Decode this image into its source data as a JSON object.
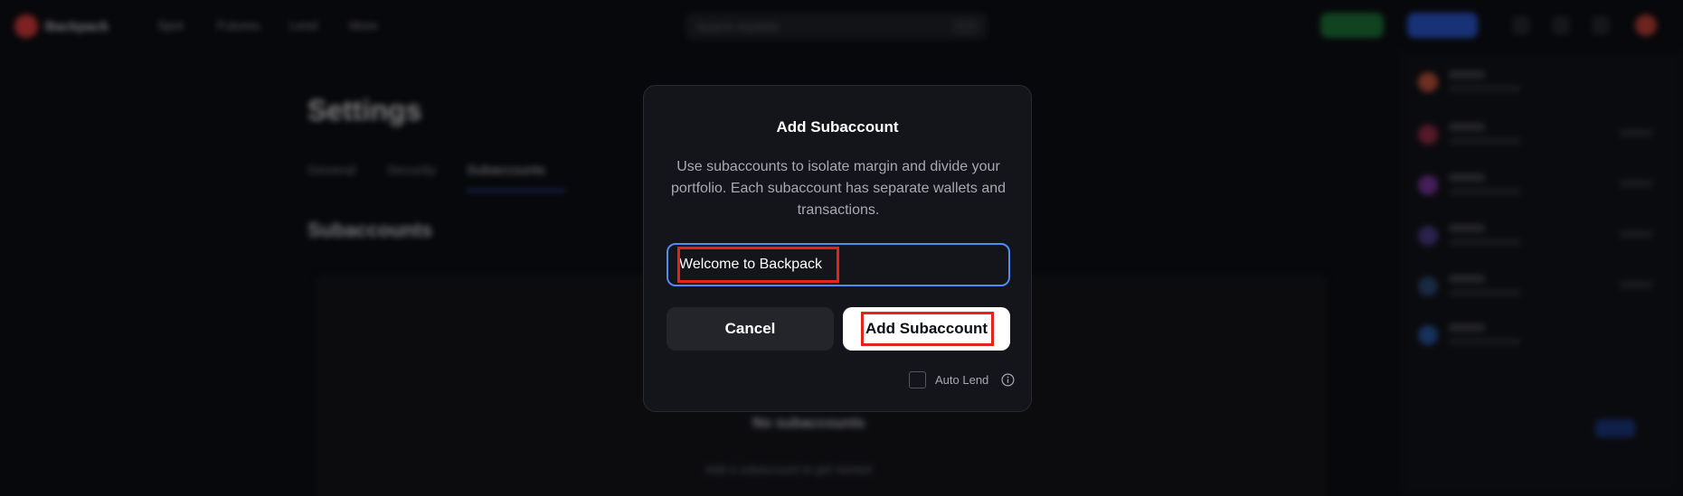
{
  "app": {
    "logo_text": "Backpack",
    "nav": [
      "Spot",
      "Futures",
      "Lend",
      "More"
    ],
    "search_placeholder": "Search markets"
  },
  "page": {
    "title": "Settings",
    "tabs": [
      "General",
      "Security",
      "Subaccounts"
    ],
    "active_tab": "Subaccounts",
    "section_title": "Subaccounts",
    "empty_title": "No subaccounts",
    "empty_subtitle": "Add a subaccount to get started"
  },
  "modal": {
    "title": "Add Subaccount",
    "description": "Use subaccounts to isolate margin and divide your portfolio. Each subaccount has separate wallets and transactions.",
    "name_input": {
      "value": "Welcome to Backpack"
    },
    "cancel_label": "Cancel",
    "add_label": "Add Subaccount",
    "auto_lend_label": "Auto Lend",
    "auto_lend_checked": false
  },
  "colors": {
    "accent_blue": "#4f8df5",
    "highlight_red": "#e2241b",
    "brand_red": "#e33e3f"
  }
}
